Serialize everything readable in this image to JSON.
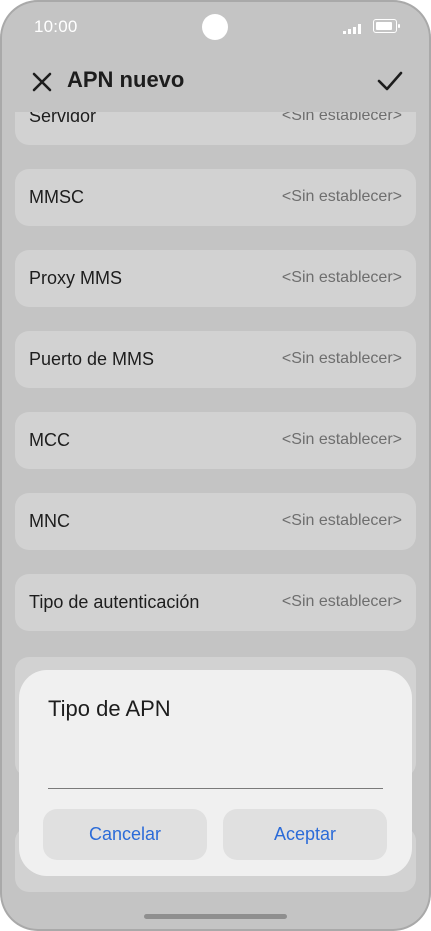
{
  "status_bar": {
    "time": "10:00"
  },
  "header": {
    "title": "APN nuevo",
    "close_icon": "close-icon",
    "confirm_icon": "checkmark-icon"
  },
  "settings": [
    {
      "label": "Servidor",
      "value": "<Sin establecer>"
    },
    {
      "label": "MMSC",
      "value": "<Sin establecer>"
    },
    {
      "label": "Proxy MMS",
      "value": "<Sin establecer>"
    },
    {
      "label": "Puerto de MMS",
      "value": "<Sin establecer>"
    },
    {
      "label": "MCC",
      "value": "<Sin establecer>"
    },
    {
      "label": "MNC",
      "value": "<Sin establecer>"
    },
    {
      "label": "Tipo de autenticación",
      "value": "<Sin establecer>"
    }
  ],
  "dialog": {
    "title": "Tipo de APN",
    "input_value": "",
    "cancel_label": "Cancelar",
    "accept_label": "Aceptar"
  },
  "colors": {
    "accent": "#2b6bd8",
    "background": "#c4c4c4",
    "row": "#d2d2d2",
    "dialog": "#f0f0f0"
  }
}
